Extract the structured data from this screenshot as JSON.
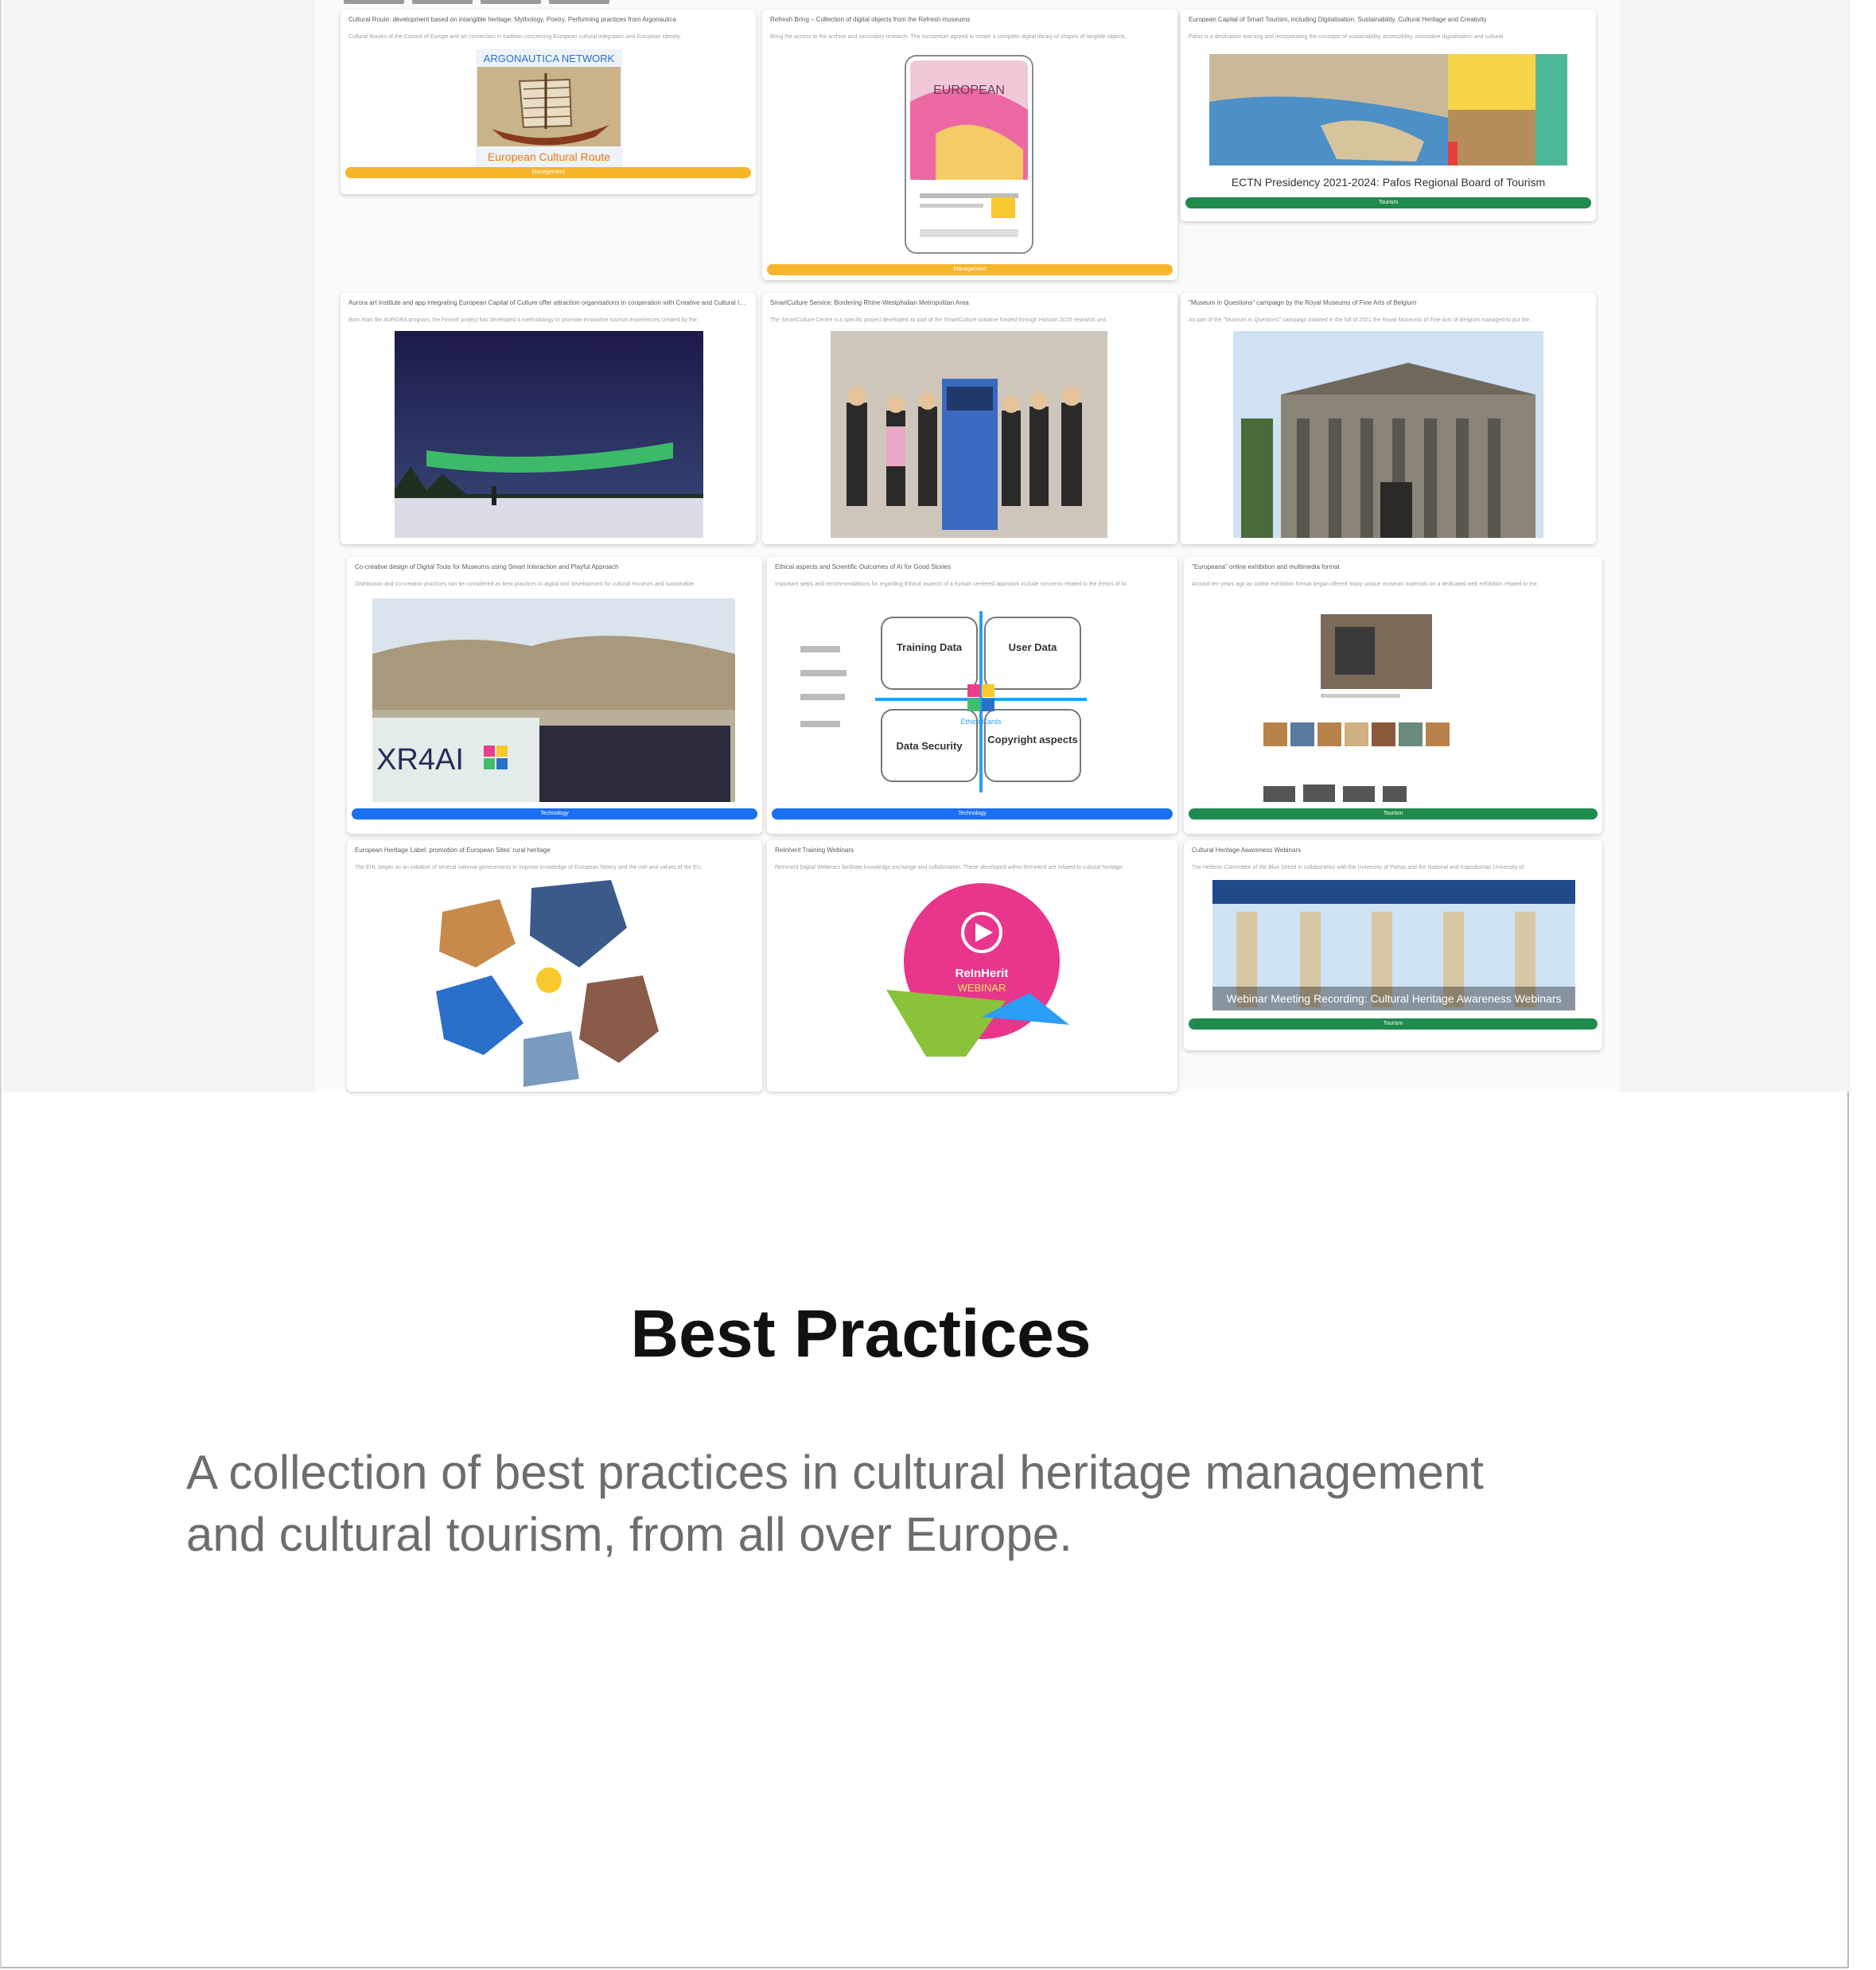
{
  "section": {
    "title": "Best Practices",
    "description": "A collection of best practices in cultural heritage management and cultural tourism, from all over Europe."
  },
  "cards": [
    {
      "title": "Cultural Route: development based on intangible heritage: Mythology, Poetry, Performing practices from Argonautica",
      "subtitle": "Cultural Routes of the Council of Europe and art connection in tradition concerning European cultural integration and European identity.",
      "thumb_text": "ARGONAUTICA NETWORK",
      "thumb_caption": "European Cultural Route",
      "button": "Management",
      "button_color": "#f7b52c"
    },
    {
      "title": "Refresh Bring – Collection of digital objects from the Refresh museums",
      "subtitle": "Bring the access to the archive and secondary research. The consortium agreed to create a complete digital library of shapes of tangible objects.",
      "thumb_text": "EUROPEAN",
      "thumb_caption": "",
      "button": "Management",
      "button_color": "#f7b52c"
    },
    {
      "title": "European Capital of Smart Tourism, including Digitalisation, Sustainability, Cultural Heritage and Creativity",
      "subtitle": "Pafos is a destination learning and incorporating the concepts of sustainability, accessibility, innovative digitalisation and cultural.",
      "thumb_text": "",
      "thumb_caption": "ECTN Presidency 2021-2024: Pafos Regional Board of Tourism",
      "button": "Tourism",
      "button_color": "#1e8a4c"
    },
    {
      "title": "Aurora art Institute and app integrating European Capital of Culture offer attraction organisations in cooperation with Creative and Cultural Industries",
      "subtitle": "Born from the AURORA program, the Finnish project has developed a methodology to promote innovative tourism experiences created by the.",
      "thumb_text": "",
      "thumb_caption": "",
      "button": "",
      "button_color": ""
    },
    {
      "title": "SmartCulture Service: Bordering Rhine-Westphalian Metropolitan Area",
      "subtitle": "The SmartCulture Centre is a specific project developed as part of the SmartCulture initiative funded through Horizon 2020 research unit.",
      "thumb_text": "",
      "thumb_caption": "",
      "button": "",
      "button_color": ""
    },
    {
      "title": "\"Museum in Questions\" campaign by the Royal Museums of Fine Arts of Belgium",
      "subtitle": "As part of the \"Museum in Questions\" campaign initiated in the fall of 2021 the Royal Museums of Fine Arts of Belgium managed to put the.",
      "thumb_text": "",
      "thumb_caption": "",
      "button": "",
      "button_color": ""
    },
    {
      "title": "Co-creative design of Digital Tools for Museums using Smart Interaction and Playful Approach",
      "subtitle": "Distribution and co-creation practices can be considered as best practices in digital tool development for cultural museum and sustainable.",
      "thumb_text": "XR4AI",
      "thumb_caption": "",
      "button": "Technology",
      "button_color": "#1a6ff2"
    },
    {
      "title": "Ethical aspects and Scientific Outcomes of AI for Good Stories",
      "subtitle": "Important steps and recommendations for regarding Ethical aspects of a human centered approach include concerns related to the Ethics of AI.",
      "thumb_text": "",
      "thumb_caption": "",
      "button": "Technology",
      "button_color": "#1a6ff2"
    },
    {
      "title": "\"Europeana\" online exhibition and multimedia format",
      "subtitle": "Around ten years ago an online exhibition format began offered many unique museum materials on a dedicated web exhibition related to the.",
      "thumb_text": "",
      "thumb_caption": "",
      "button": "Tourism",
      "button_color": "#1e8a4c"
    },
    {
      "title": "European Heritage Label: promotion of European Sites' rural heritage",
      "subtitle": "The EHL began as an initiative of several national governments to improve knowledge of European history and the role and values of the EU.",
      "thumb_text": "",
      "thumb_caption": "",
      "button": "",
      "button_color": "#f7b52c"
    },
    {
      "title": "ReInherit Training Webinars",
      "subtitle": "ReInHerit Digital Webinars facilitate knowledge exchange and collaboration. These developed within ReInHerit are related to cultural heritage.",
      "thumb_text": "ReInHerit",
      "thumb_caption": "WEBINAR",
      "button": "",
      "button_color": ""
    },
    {
      "title": "Cultural Heritage Awareness Webinars",
      "subtitle": "The Hellenic Committee of the Blue Shield in collaboration with the University of Patras and the National and Kapodistrian University of.",
      "thumb_text": "",
      "thumb_caption": "Webinar Meeting Recording: Cultural Heritage Awareness Webinars",
      "button": "Tourism",
      "button_color": "#1e8a4c"
    }
  ],
  "diagram_labels": {
    "q1": "Training Data",
    "q2": "User Data",
    "q3": "Data Security",
    "q4": "Copyright aspects",
    "center": "Ethics Cards"
  }
}
